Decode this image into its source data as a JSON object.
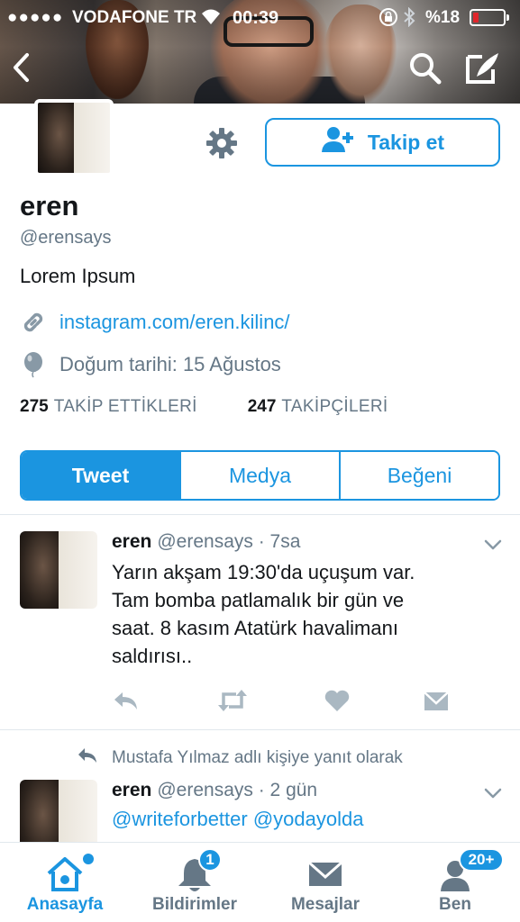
{
  "status_bar": {
    "signal": "●●●●●",
    "carrier": "VODAFONE TR",
    "time": "00:39",
    "battery_text": "%18",
    "battery_level": 0.18
  },
  "profile": {
    "follow_label": "Takip et",
    "name": "eren",
    "handle": "@erensays",
    "bio": "Lorem Ipsum",
    "website": "instagram.com/eren.kilinc/",
    "birthday": "Doğum tarihi: 15 Ağustos",
    "following_count": "275",
    "following_label": "TAKİP ETTİKLERİ",
    "followers_count": "247",
    "followers_label": "TAKİPÇİLERİ"
  },
  "tabs": [
    "Tweet",
    "Medya",
    "Beğeni"
  ],
  "tweets": [
    {
      "name": "eren",
      "meta": "@erensays · 7sa",
      "lines": [
        "Yarın akşam 19:30'da uçuşum var.",
        "Tam bomba patlamalık bir gün ve",
        "saat. 8 kasım Atatürk havalimanı",
        "saldırısı.."
      ]
    },
    {
      "reply_context": "Mustafa Yılmaz adlı kişiye yanıt olarak",
      "name": "eren",
      "meta": "@erensays · 2 gün",
      "mentions": "@writeforbetter @yodayolda"
    }
  ],
  "tabbar": {
    "home": "Anasayfa",
    "notifications": "Bildirimler",
    "notifications_badge": "1",
    "messages": "Mesajlar",
    "me": "Ben",
    "me_badge": "20+"
  },
  "colors": {
    "accent": "#1b95e0",
    "secondary_text": "#657786",
    "icon_gray": "#8899a6",
    "battery_low": "#e0252b"
  }
}
